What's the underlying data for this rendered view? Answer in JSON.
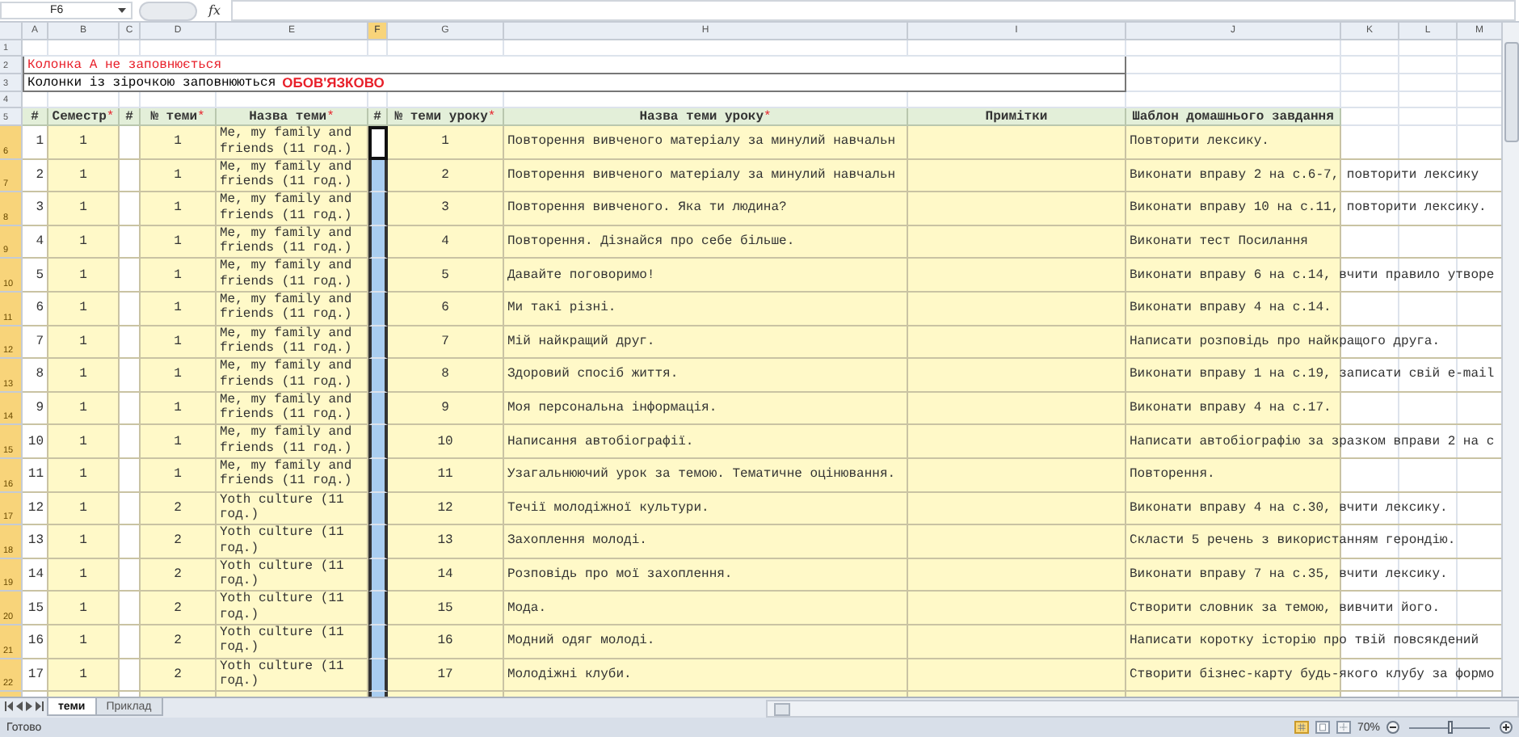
{
  "formula_bar": {
    "name_box": "F6",
    "function_label": "fx"
  },
  "column_headers": [
    {
      "label": "A",
      "selected": false
    },
    {
      "label": "B",
      "selected": false
    },
    {
      "label": "C",
      "selected": false
    },
    {
      "label": "D",
      "selected": false
    },
    {
      "label": "E",
      "selected": false
    },
    {
      "label": "F",
      "selected": true
    },
    {
      "label": "G",
      "selected": false
    },
    {
      "label": "H",
      "selected": false
    },
    {
      "label": "I",
      "selected": false
    },
    {
      "label": "J",
      "selected": false
    },
    {
      "label": "K",
      "selected": false
    },
    {
      "label": "L",
      "selected": false
    },
    {
      "label": "M",
      "selected": false
    }
  ],
  "top_rows": [
    {
      "number": "1",
      "selected": false
    },
    {
      "number": "2",
      "selected": false,
      "note": "Колонка А не заповнюється"
    },
    {
      "number": "3",
      "selected": false,
      "note": "Колонки із зірочкою заповнюються",
      "emphasis": "ОБОВ'ЯЗКОВО"
    },
    {
      "number": "4",
      "selected": false
    }
  ],
  "header_row": {
    "number": "5",
    "selected": false,
    "cells": [
      {
        "label": "#"
      },
      {
        "label": "Семестр",
        "required_mark": "*"
      },
      {
        "label": "#"
      },
      {
        "label": "№ теми",
        "required_mark": "*"
      },
      {
        "label": "Назва теми",
        "required_mark": "*"
      },
      {
        "label": "#"
      },
      {
        "label": "№ теми уроку",
        "required_mark": "*"
      },
      {
        "label": "Назва теми уроку",
        "required_mark": "*"
      },
      {
        "label": "Примітки"
      },
      {
        "label": "Шаблон домашнього завдання"
      }
    ]
  },
  "rows": [
    {
      "number": "6",
      "selected": true,
      "num": "1",
      "semester": "1",
      "topic_no": "1",
      "topic": "Me, my family and friends (11 год.)",
      "lesson_no": "1",
      "lesson": "Повторення вивченого матеріалу за минулий навчальн",
      "homework": "Повторити лексику."
    },
    {
      "number": "7",
      "selected": true,
      "num": "2",
      "semester": "1",
      "topic_no": "1",
      "topic": "Me, my family and friends (11 год.)",
      "lesson_no": "2",
      "lesson": "Повторення вивченого матеріалу за минулий навчальн",
      "homework": "Виконати вправу 2 на с.6-7, повторити лексику"
    },
    {
      "number": "8",
      "selected": true,
      "num": "3",
      "semester": "1",
      "topic_no": "1",
      "topic": "Me, my family and friends (11 год.)",
      "lesson_no": "3",
      "lesson": "Повторення вивченого. Яка ти людина?",
      "homework": "Виконати вправу 10 на с.11, повторити лексику."
    },
    {
      "number": "9",
      "selected": true,
      "num": "4",
      "semester": "1",
      "topic_no": "1",
      "topic": "Me, my family and friends (11 год.)",
      "lesson_no": "4",
      "lesson": "Повторення. Дізнайся про себе більше.",
      "homework": "Виконати тест Посилання"
    },
    {
      "number": "10",
      "selected": true,
      "num": "5",
      "semester": "1",
      "topic_no": "1",
      "topic": "Me, my family and friends (11 год.)",
      "lesson_no": "5",
      "lesson": "Давайте поговоримо!",
      "homework": "Виконати вправу 6 на с.14, вчити правило утворе"
    },
    {
      "number": "11",
      "selected": true,
      "num": "6",
      "semester": "1",
      "topic_no": "1",
      "topic": "Me, my family and friends (11 год.)",
      "lesson_no": "6",
      "lesson": "Ми такі різні.",
      "homework": "Виконати вправу 4 на с.14."
    },
    {
      "number": "12",
      "selected": true,
      "num": "7",
      "semester": "1",
      "topic_no": "1",
      "topic": "Me, my family and friends (11 год.)",
      "lesson_no": "7",
      "lesson": "Мій найкращий друг.",
      "homework": "Написати розповідь про найкращого друга."
    },
    {
      "number": "13",
      "selected": true,
      "num": "8",
      "semester": "1",
      "topic_no": "1",
      "topic": "Me, my family and friends (11 год.)",
      "lesson_no": "8",
      "lesson": "Здоровий спосіб життя.",
      "homework": "Виконати вправу 1 на с.19, записати свій e-mail"
    },
    {
      "number": "14",
      "selected": true,
      "num": "9",
      "semester": "1",
      "topic_no": "1",
      "topic": "Me, my family and friends (11 год.)",
      "lesson_no": "9",
      "lesson": "Моя персональна інформація.",
      "homework": "Виконати вправу 4 на с.17."
    },
    {
      "number": "15",
      "selected": true,
      "num": "10",
      "semester": "1",
      "topic_no": "1",
      "topic": "Me, my family and friends (11 год.)",
      "lesson_no": "10",
      "lesson": "Написання автобіографії.",
      "homework": "Написати автобіографію за зразком вправи 2 на с"
    },
    {
      "number": "16",
      "selected": true,
      "num": "11",
      "semester": "1",
      "topic_no": "1",
      "topic": "Me, my family and friends (11 год.)",
      "lesson_no": "11",
      "lesson": "Узагальнюючий урок за темою. Тематичне оцінювання.",
      "homework": "Повторення."
    },
    {
      "number": "17",
      "selected": true,
      "num": "12",
      "semester": "1",
      "topic_no": "2",
      "topic": "Yoth culture (11 год.)",
      "lesson_no": "12",
      "lesson": "Течії молодіжної культури.",
      "homework": "Виконати вправу 4 на с.30, вчити лексику."
    },
    {
      "number": "18",
      "selected": true,
      "num": "13",
      "semester": "1",
      "topic_no": "2",
      "topic": "Yoth culture (11 год.)",
      "lesson_no": "13",
      "lesson": "Захоплення молоді.",
      "homework": "Скласти 5 речень з використанням герондію."
    },
    {
      "number": "19",
      "selected": true,
      "num": "14",
      "semester": "1",
      "topic_no": "2",
      "topic": "Yoth culture (11 год.)",
      "lesson_no": "14",
      "lesson": "Розповідь про мої захоплення.",
      "homework": "Виконати вправу 7 на с.35, вчити лексику."
    },
    {
      "number": "20",
      "selected": true,
      "num": "15",
      "semester": "1",
      "topic_no": "2",
      "topic": "Yoth culture (11 год.)",
      "lesson_no": "15",
      "lesson": "Мода.",
      "homework": "Створити словник за темою, вивчити його."
    },
    {
      "number": "21",
      "selected": true,
      "num": "16",
      "semester": "1",
      "topic_no": "2",
      "topic": "Yoth culture (11 год.)",
      "lesson_no": "16",
      "lesson": "Модний одяг молоді.",
      "homework": "Написати коротку історію про твій повсякдений"
    },
    {
      "number": "22",
      "selected": true,
      "num": "17",
      "semester": "1",
      "topic_no": "2",
      "topic": "Yoth culture (11 год.)",
      "lesson_no": "17",
      "lesson": "Молодіжні клуби.",
      "homework": "Створити бізнес-карту будь-якого клубу за формо"
    }
  ],
  "sheet_tabs": [
    {
      "label": "теми",
      "selected": true
    },
    {
      "label": "Приклад",
      "selected": false
    }
  ],
  "status_bar": {
    "status": "Готово",
    "views": [
      {
        "kind": "normal",
        "selected": true
      },
      {
        "kind": "layout",
        "selected": false
      },
      {
        "kind": "pagebreak",
        "selected": false
      }
    ],
    "zoom": "70%",
    "zoom_slider": {
      "level": 0.5
    }
  }
}
